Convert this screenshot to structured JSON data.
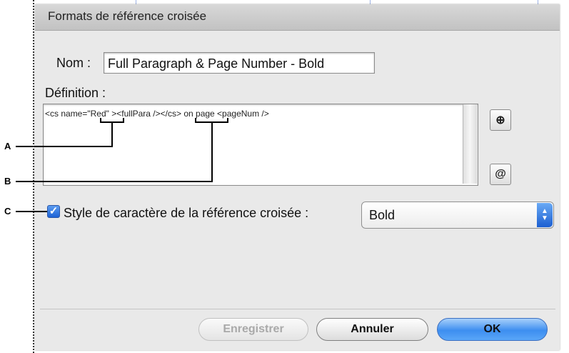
{
  "dialog": {
    "title": "Formats de référence croisée",
    "name_label": "Nom :",
    "name_value": "Full Paragraph & Page Number - Bold",
    "definition_label": "Définition :",
    "definition": {
      "part1": "<cs name=",
      "part2": "\"Red\"",
      "part3": " ><fullPara />",
      "part4": "</cs>",
      "part5": " on page <pageNum />"
    },
    "insert_special_icon": "plus-tag-icon",
    "insert_char_icon": "at-sign-icon",
    "checkbox_checked": true,
    "checkbox_label": "Style de caractère de la référence croisée :",
    "style_select_value": "Bold",
    "buttons": {
      "save": "Enregistrer",
      "cancel": "Annuler",
      "ok": "OK"
    }
  },
  "callouts": {
    "a": "A",
    "b": "B",
    "c": "C"
  },
  "colors": {
    "accent": "#3d8ef0",
    "dialog_bg": "#e9e9e9"
  }
}
